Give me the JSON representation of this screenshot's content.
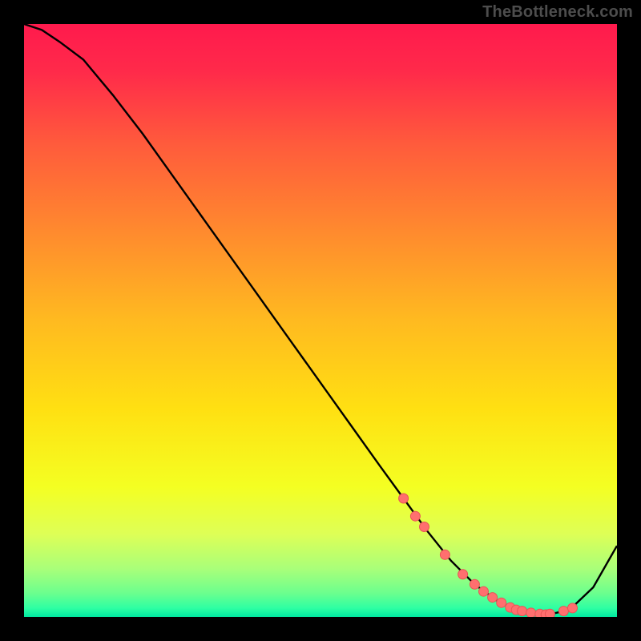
{
  "watermark": "TheBottleneck.com",
  "colors": {
    "bg_black": "#000000",
    "curve": "#000000",
    "marker_fill": "#ff6f6f",
    "marker_stroke": "#e85555",
    "watermark": "#4d4d4d"
  },
  "chart_data": {
    "type": "line",
    "title": "",
    "xlabel": "",
    "ylabel": "",
    "xlim": [
      0,
      100
    ],
    "ylim": [
      0,
      100
    ],
    "gradient_stops": [
      {
        "offset": 0.0,
        "color": "#ff1a4d"
      },
      {
        "offset": 0.08,
        "color": "#ff2a4a"
      },
      {
        "offset": 0.2,
        "color": "#ff5a3c"
      },
      {
        "offset": 0.35,
        "color": "#ff8a2e"
      },
      {
        "offset": 0.5,
        "color": "#ffba20"
      },
      {
        "offset": 0.65,
        "color": "#ffe012"
      },
      {
        "offset": 0.78,
        "color": "#f4ff22"
      },
      {
        "offset": 0.86,
        "color": "#deff56"
      },
      {
        "offset": 0.92,
        "color": "#a8ff7a"
      },
      {
        "offset": 0.96,
        "color": "#6bff8e"
      },
      {
        "offset": 0.985,
        "color": "#2effa3"
      },
      {
        "offset": 1.0,
        "color": "#00e8a0"
      }
    ],
    "series": [
      {
        "name": "bottleneck-curve",
        "x": [
          0,
          3,
          6,
          10,
          15,
          20,
          25,
          30,
          35,
          40,
          45,
          50,
          55,
          60,
          64,
          68,
          72,
          76,
          80,
          84,
          88,
          92,
          96,
          100
        ],
        "y": [
          100,
          99,
          97,
          94,
          88,
          81.5,
          74.5,
          67.5,
          60.5,
          53.5,
          46.5,
          39.5,
          32.5,
          25.5,
          20,
          14.5,
          9.5,
          5.5,
          2.6,
          1.0,
          0.3,
          1.2,
          5.0,
          12
        ]
      }
    ],
    "markers": {
      "name": "highlight-points",
      "x": [
        64,
        66,
        67.5,
        71,
        74,
        76,
        77.5,
        79,
        80.5,
        82,
        83,
        84,
        85.5,
        87,
        88,
        88.7,
        91,
        92.5
      ],
      "y": [
        20,
        17,
        15.2,
        10.5,
        7.2,
        5.5,
        4.3,
        3.3,
        2.4,
        1.6,
        1.2,
        1.0,
        0.7,
        0.5,
        0.4,
        0.5,
        1.0,
        1.5
      ]
    }
  }
}
